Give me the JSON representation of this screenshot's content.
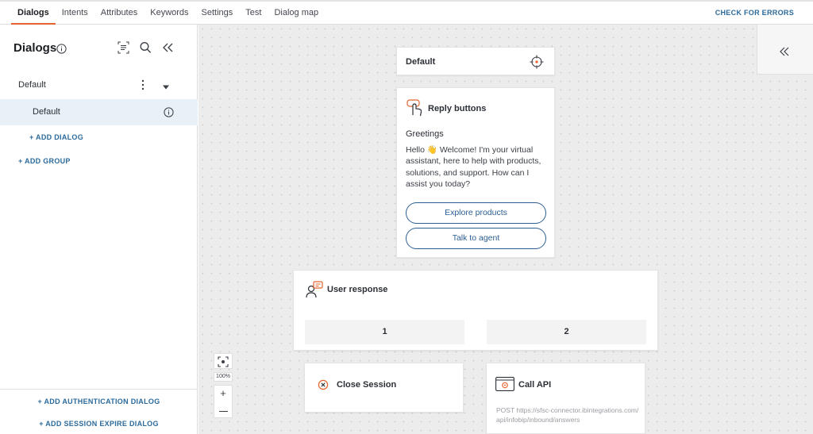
{
  "nav": {
    "tabs": [
      "Dialogs",
      "Intents",
      "Attributes",
      "Keywords",
      "Settings",
      "Test",
      "Dialog map"
    ],
    "active_tab": "Dialogs",
    "check_errors": "CHECK FOR ERRORS"
  },
  "sidebar": {
    "title": "Dialogs",
    "group_name": "Default",
    "dialog_name": "Default",
    "add_dialog": "+ ADD DIALOG",
    "add_group": "+ ADD GROUP",
    "add_auth_dialog": "+ ADD AUTHENTICATION DIALOG",
    "add_session_expire_dialog": "+ ADD SESSION EXPIRE DIALOG"
  },
  "canvas": {
    "default_card": {
      "title": "Default"
    },
    "reply_card": {
      "title": "Reply buttons",
      "subtitle": "Greetings",
      "message": "Hello 👋 Welcome! I'm your virtual assistant, here to help with products, solutions, and support. How can I assist you today?",
      "buttons": [
        "Explore products",
        "Talk to agent"
      ]
    },
    "user_response_card": {
      "title": "User response",
      "options": [
        "1",
        "2"
      ]
    },
    "close_session_card": {
      "title": "Close Session"
    },
    "call_api_card": {
      "title": "Call API",
      "url": "POST https://sfsc-connector.ibintegrations.com/api/infobip/inbound/answers"
    },
    "zoom": "100%"
  },
  "colors": {
    "accent_orange": "#e3642e",
    "link_blue": "#2b6a9b",
    "selected_row": "#e8f0f8",
    "canvas_bg": "#ececec"
  }
}
